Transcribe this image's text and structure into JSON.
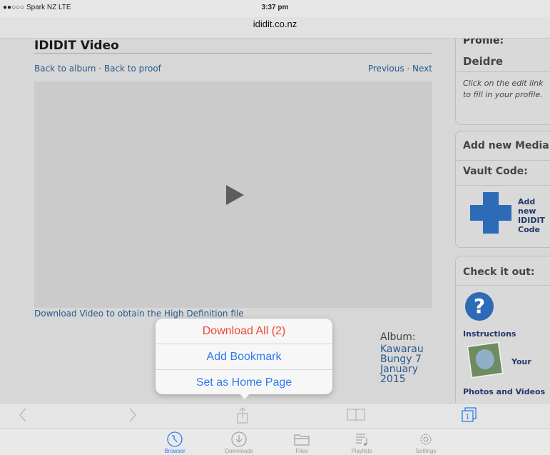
{
  "status": {
    "carrier": "●●○○○ Spark NZ  LTE",
    "time": "3:37 pm"
  },
  "browser": {
    "url": "ididit.co.nz"
  },
  "page": {
    "title": "IDIDIT Video",
    "back_to_album": "Back to album",
    "nav_sep": " · ",
    "back_to_proof": "Back to proof",
    "previous": "Previous",
    "next": "Next",
    "download_note": "Download Video to obtain the High Definition file",
    "album_label": "Album:",
    "album_value": "Kawarau Bungy 7 January 2015"
  },
  "sidebar": {
    "profile_head": "Profile:",
    "profile_name": "Deidre",
    "profile_hint": "Click on the edit link to fill in your profile.",
    "add_media_head": "Add new Media",
    "vault_code": "Vault Code:",
    "add_code": "Add new IDIDIT Code",
    "check_head": "Check it out:",
    "instructions": "Instructions",
    "your": "Your",
    "photos_videos": "Photos and Videos"
  },
  "popover": {
    "download_all": "Download All (2)",
    "add_bookmark": "Add Bookmark",
    "set_home": "Set as Home Page"
  },
  "tabs": [
    {
      "label": "Browser",
      "icon": "compass-icon"
    },
    {
      "label": "Downloads",
      "icon": "download-icon"
    },
    {
      "label": "Files",
      "icon": "folder-icon"
    },
    {
      "label": "Playlists",
      "icon": "playlist-icon"
    },
    {
      "label": "Settings",
      "icon": "gear-icon"
    }
  ],
  "toolbar": {
    "tab_count": "1"
  },
  "colors": {
    "accent": "#2d7bf0",
    "destructive": "#f24236",
    "link": "#2a5a8a"
  }
}
